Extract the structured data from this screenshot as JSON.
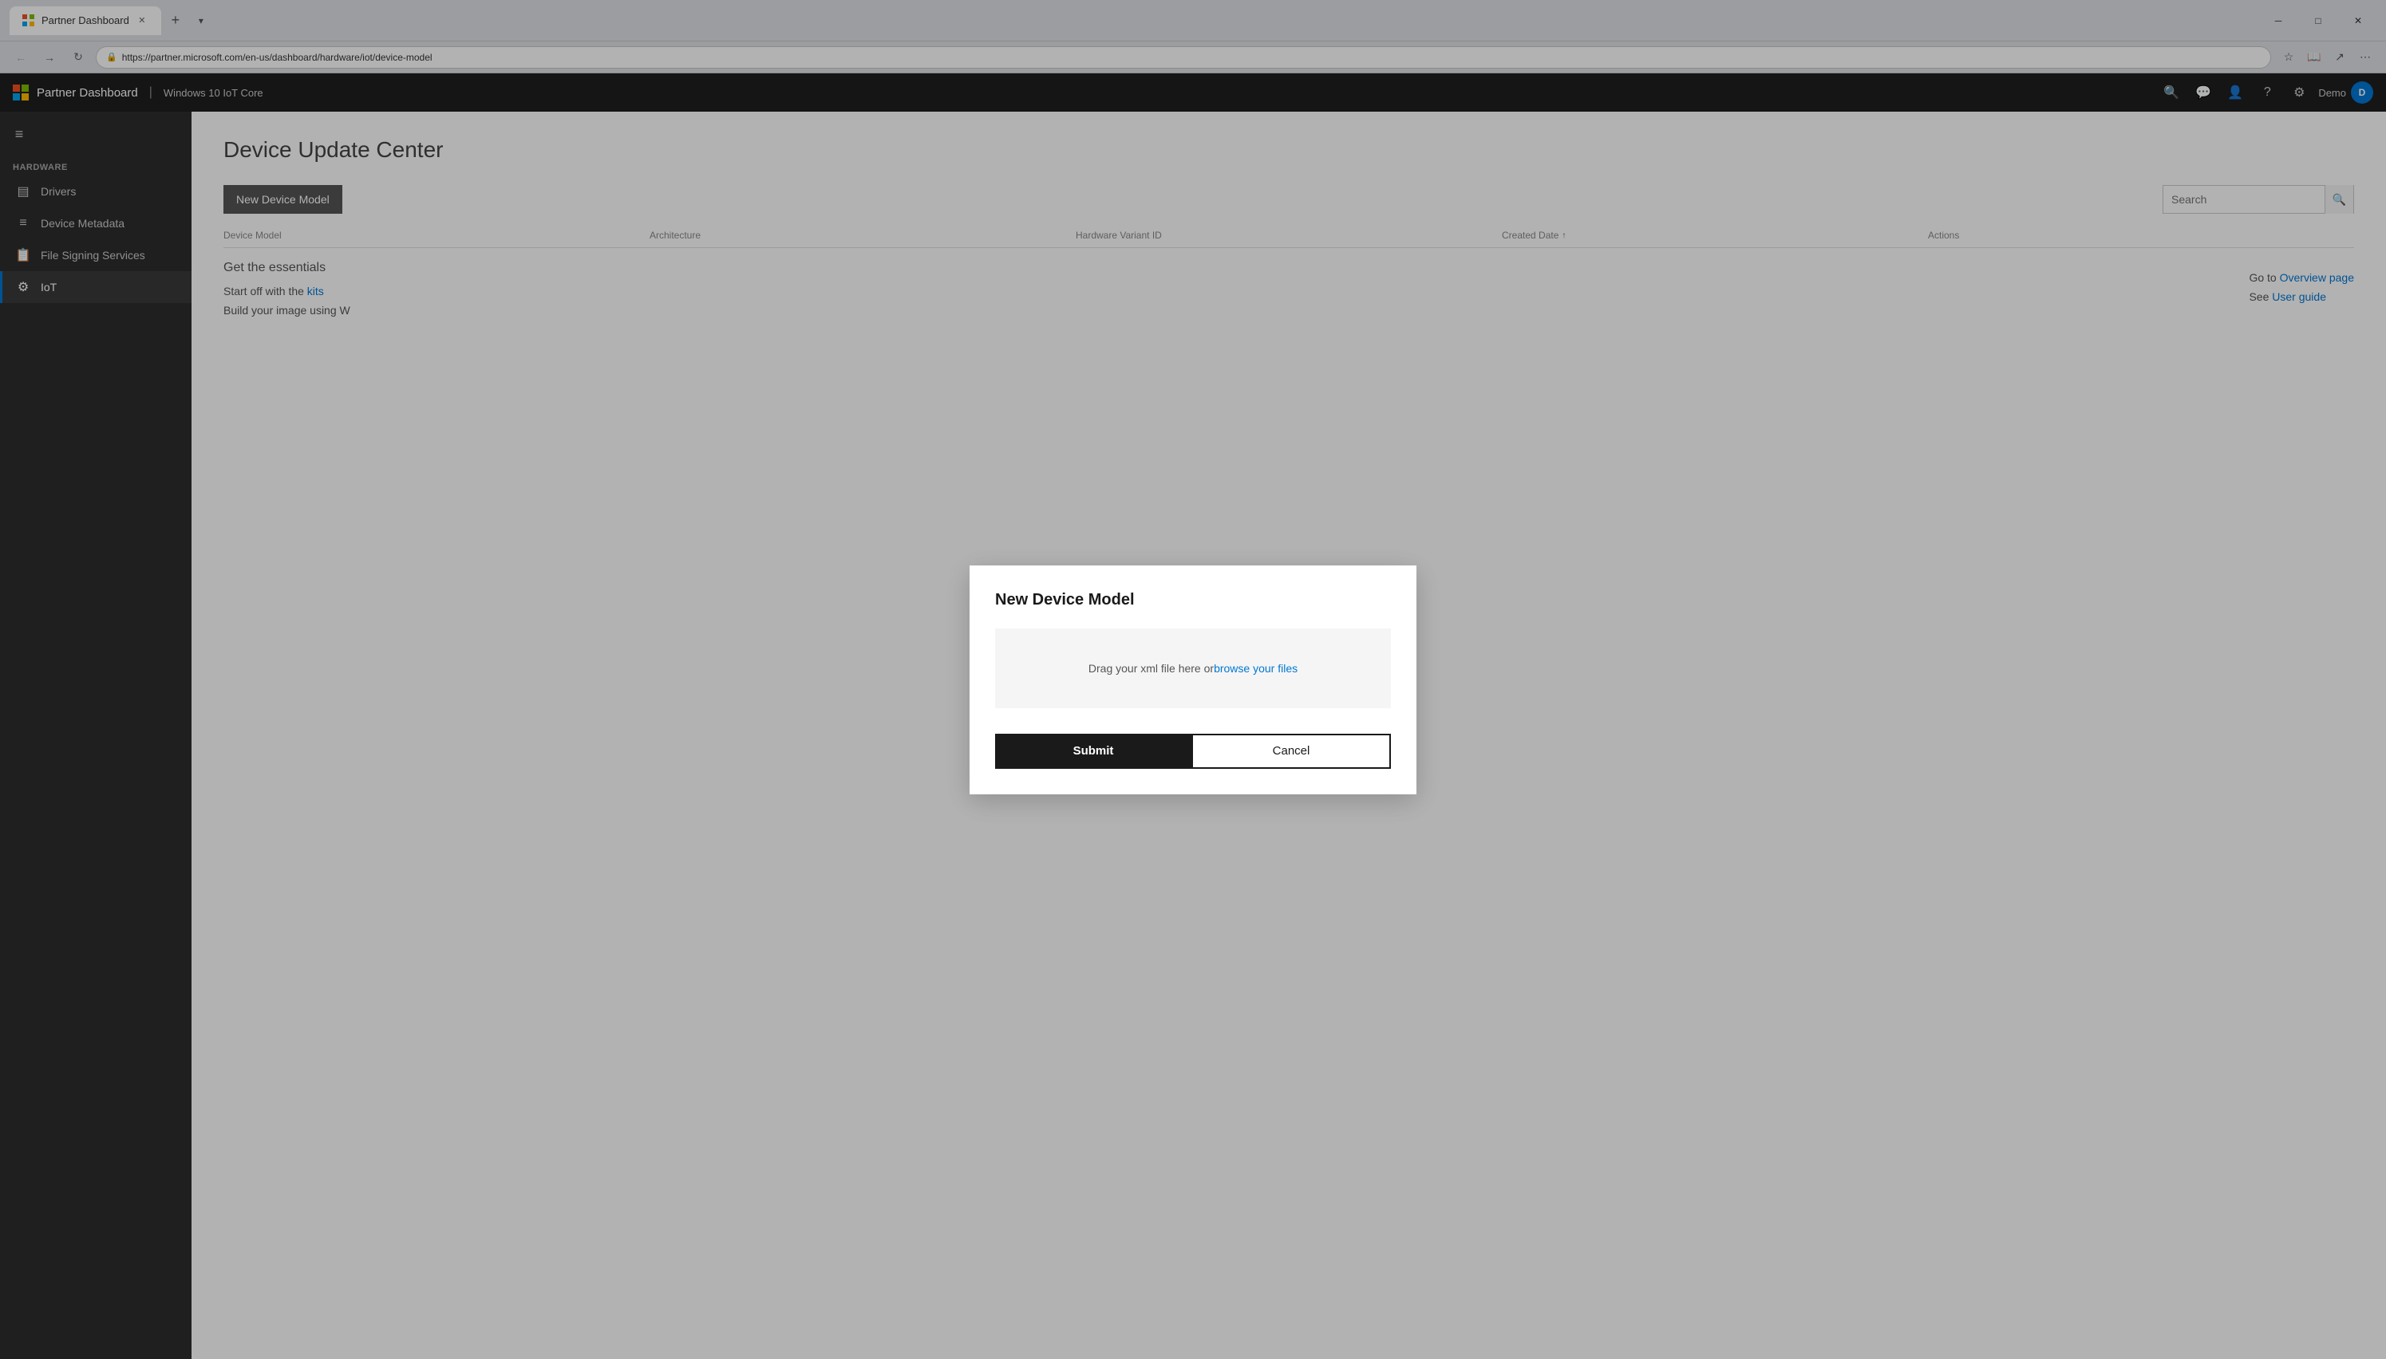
{
  "browser": {
    "tab_title": "Partner Dashboard",
    "url": "https://partner.microsoft.com/en-us/dashboard/hardware/iot/device-model",
    "new_tab_icon": "+",
    "tab_dropdown_icon": "▾",
    "window_controls": {
      "minimize": "─",
      "maximize": "□",
      "close": "✕"
    },
    "nav": {
      "back": "←",
      "forward": "→",
      "refresh": "↻",
      "more": "⋯"
    },
    "address_bar_icons": {
      "favorites": "☆",
      "read": "📖",
      "share": "↗",
      "more": "⋯"
    }
  },
  "topbar": {
    "app_title": "Partner Dashboard",
    "divider": "|",
    "subtitle": "Windows 10 IoT Core",
    "icons": {
      "search": "🔍",
      "chat": "💬",
      "people": "👤",
      "help": "?",
      "settings": "⚙"
    },
    "user": {
      "name": "Demo",
      "avatar_initials": "D"
    }
  },
  "sidebar": {
    "hamburger": "≡",
    "section_label": "HARDWARE",
    "items": [
      {
        "id": "drivers",
        "label": "Drivers",
        "icon": "▤"
      },
      {
        "id": "device-metadata",
        "label": "Device Metadata",
        "icon": "≡"
      },
      {
        "id": "file-signing",
        "label": "File Signing Services",
        "icon": "📋"
      },
      {
        "id": "iot",
        "label": "IoT",
        "icon": "⚙",
        "active": true
      }
    ]
  },
  "page": {
    "title": "Device Update Center",
    "toolbar": {
      "new_device_model_label": "New Device Model",
      "search_placeholder": "Search"
    },
    "table": {
      "columns": [
        {
          "label": "Device Model",
          "sortable": false
        },
        {
          "label": "Architecture",
          "sortable": false
        },
        {
          "label": "Hardware Variant ID",
          "sortable": false
        },
        {
          "label": "Created Date",
          "sortable": true,
          "sort_dir": "↑"
        },
        {
          "label": "Actions",
          "sortable": false
        }
      ]
    },
    "content": {
      "get_essentials_label": "Get the essentials",
      "start_text": "Start off with the ",
      "kits_link": "kits",
      "build_text": "Build your image using W",
      "side_links": [
        {
          "prefix": "Go to ",
          "link_text": "Overview page"
        },
        {
          "prefix": "See ",
          "link_text": "User guide"
        }
      ]
    }
  },
  "dialog": {
    "title": "New Device Model",
    "drop_zone": {
      "text": "Drag your xml file here or ",
      "link_text": "browse your files"
    },
    "submit_label": "Submit",
    "cancel_label": "Cancel"
  }
}
